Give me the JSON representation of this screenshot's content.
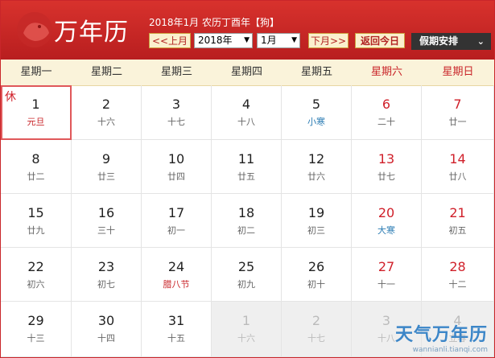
{
  "header": {
    "title": "万年历",
    "date_info": "2018年1月 农历丁酉年【狗】",
    "prev_label": "<<上月",
    "year_value": "2018年",
    "month_value": "1月",
    "next_label": "下月>>",
    "today_label": "返回今日",
    "holiday_label": "假期安排"
  },
  "weekdays": [
    "星期一",
    "星期二",
    "星期三",
    "星期四",
    "星期五",
    "星期六",
    "星期日"
  ],
  "weeks": [
    [
      {
        "d": "1",
        "l": "元旦",
        "k": "fest",
        "rest": "休",
        "today": true
      },
      {
        "d": "2",
        "l": "十六"
      },
      {
        "d": "3",
        "l": "十七"
      },
      {
        "d": "4",
        "l": "十八"
      },
      {
        "d": "5",
        "l": "小寒",
        "k": "term"
      },
      {
        "d": "6",
        "l": "二十"
      },
      {
        "d": "7",
        "l": "廿一"
      }
    ],
    [
      {
        "d": "8",
        "l": "廿二"
      },
      {
        "d": "9",
        "l": "廿三"
      },
      {
        "d": "10",
        "l": "廿四"
      },
      {
        "d": "11",
        "l": "廿五"
      },
      {
        "d": "12",
        "l": "廿六"
      },
      {
        "d": "13",
        "l": "廿七"
      },
      {
        "d": "14",
        "l": "廿八"
      }
    ],
    [
      {
        "d": "15",
        "l": "廿九"
      },
      {
        "d": "16",
        "l": "三十"
      },
      {
        "d": "17",
        "l": "初一"
      },
      {
        "d": "18",
        "l": "初二"
      },
      {
        "d": "19",
        "l": "初三"
      },
      {
        "d": "20",
        "l": "大寒",
        "k": "term"
      },
      {
        "d": "21",
        "l": "初五"
      }
    ],
    [
      {
        "d": "22",
        "l": "初六"
      },
      {
        "d": "23",
        "l": "初七"
      },
      {
        "d": "24",
        "l": "腊八节",
        "k": "fest"
      },
      {
        "d": "25",
        "l": "初九"
      },
      {
        "d": "26",
        "l": "初十"
      },
      {
        "d": "27",
        "l": "十一"
      },
      {
        "d": "28",
        "l": "十二"
      }
    ],
    [
      {
        "d": "29",
        "l": "十三"
      },
      {
        "d": "30",
        "l": "十四"
      },
      {
        "d": "31",
        "l": "十五"
      },
      {
        "d": "1",
        "l": "十六",
        "other": true
      },
      {
        "d": "2",
        "l": "十七",
        "other": true
      },
      {
        "d": "3",
        "l": "十八",
        "other": true
      },
      {
        "d": "4",
        "l": "立春",
        "other": true
      }
    ]
  ],
  "watermark": {
    "name": "天气万年历",
    "url": "wannianli.tianqi.com"
  },
  "colors": {
    "header_red": "#c9262a",
    "weekend_red": "#d0202a",
    "term_blue": "#2a7bb3",
    "week_header_bg": "#faf3da"
  }
}
